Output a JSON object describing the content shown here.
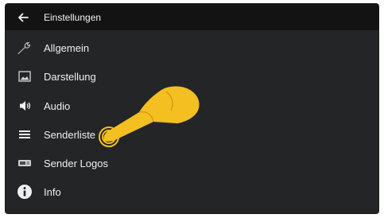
{
  "header": {
    "back_icon": "arrow-left-icon",
    "title": "Einstellungen"
  },
  "menu": {
    "items": [
      {
        "id": "allgemein",
        "label": "Allgemein",
        "icon": "wrench-icon"
      },
      {
        "id": "darstellung",
        "label": "Darstellung",
        "icon": "picture-icon"
      },
      {
        "id": "audio",
        "label": "Audio",
        "icon": "speaker-icon"
      },
      {
        "id": "senderliste",
        "label": "Senderliste",
        "icon": "list-icon"
      },
      {
        "id": "sender-logos",
        "label": "Sender Logos",
        "icon": "logo-icon"
      },
      {
        "id": "info",
        "label": "Info",
        "icon": "info-icon"
      }
    ]
  },
  "overlay": {
    "icon": "pointing-hand-icon"
  },
  "colors": {
    "background": "#242526",
    "header": "#131313",
    "text": "#f0f0f0",
    "hand": "#f4c021"
  }
}
